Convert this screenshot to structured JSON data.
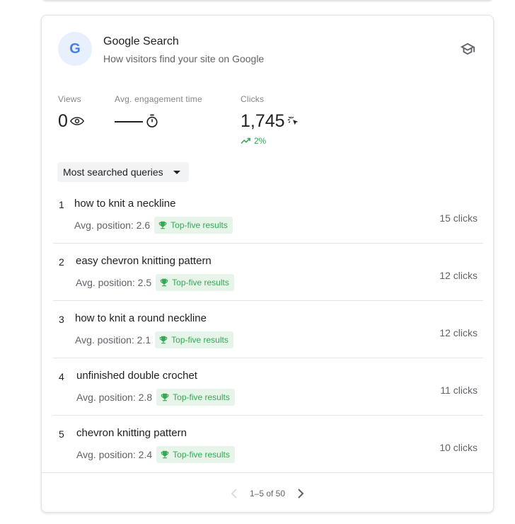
{
  "card": {
    "icon_letter": "G",
    "title": "Google Search",
    "subtitle": "How visitors find your site on Google",
    "learn_icon": "school-icon"
  },
  "metrics": [
    {
      "label": "Views",
      "value": "0",
      "icon": "eye-icon"
    },
    {
      "label": "Avg. engagement time",
      "value": "",
      "icon": "timer-icon"
    },
    {
      "label": "Clicks",
      "value": "1,745",
      "icon": "cursor-click-icon",
      "trend": "2%",
      "trend_direction": "up"
    }
  ],
  "dropdown": {
    "selected": "Most searched queries"
  },
  "queries": [
    {
      "rank": "1",
      "query": "how to knit a neckline",
      "avg_position": "Avg. position: 2.6",
      "badge": "Top-five results",
      "clicks": "15 clicks"
    },
    {
      "rank": "2",
      "query": "easy chevron knitting pattern",
      "avg_position": "Avg. position: 2.5",
      "badge": "Top-five results",
      "clicks": "12 clicks"
    },
    {
      "rank": "3",
      "query": "how to knit a round neckline",
      "avg_position": "Avg. position: 2.1",
      "badge": "Top-five results",
      "clicks": "12 clicks"
    },
    {
      "rank": "4",
      "query": "unfinished double crochet",
      "avg_position": "Avg. position: 2.8",
      "badge": "Top-five results",
      "clicks": "11 clicks"
    },
    {
      "rank": "5",
      "query": "chevron knitting pattern",
      "avg_position": "Avg. position: 2.4",
      "badge": "Top-five results",
      "clicks": "10 clicks"
    }
  ],
  "pagination": {
    "range": "1–5 of 50"
  },
  "colors": {
    "accent_blue": "#4a7ee6",
    "badge_bg": "#e8f0fe",
    "success_green": "#34a853",
    "success_bg": "#e6f4ea"
  }
}
